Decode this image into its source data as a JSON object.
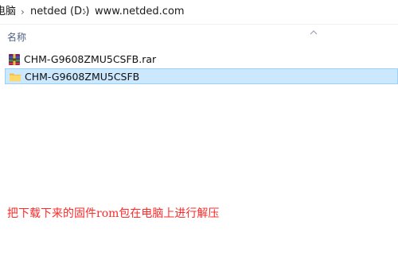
{
  "breadcrumb": {
    "items": [
      "电脑",
      "netded (D:)",
      "www.netded.com"
    ],
    "separator": "›"
  },
  "columns": {
    "name_header": "名称",
    "sort_icon": "chevron-up-icon"
  },
  "files": [
    {
      "name": "CHM-G9608ZMU5CSFB.rar",
      "icon": "winrar-archive-icon",
      "selected": false
    },
    {
      "name": "CHM-G9608ZMU5CSFB",
      "icon": "folder-icon",
      "selected": true
    }
  ],
  "caption": {
    "text": "把下载下来的固件rom包在电脑上进行解压",
    "color": "#ff2a2a"
  },
  "colors": {
    "selection_bg": "#cce8ff",
    "selection_border": "#99d1ff",
    "header_text": "#4d6082"
  }
}
